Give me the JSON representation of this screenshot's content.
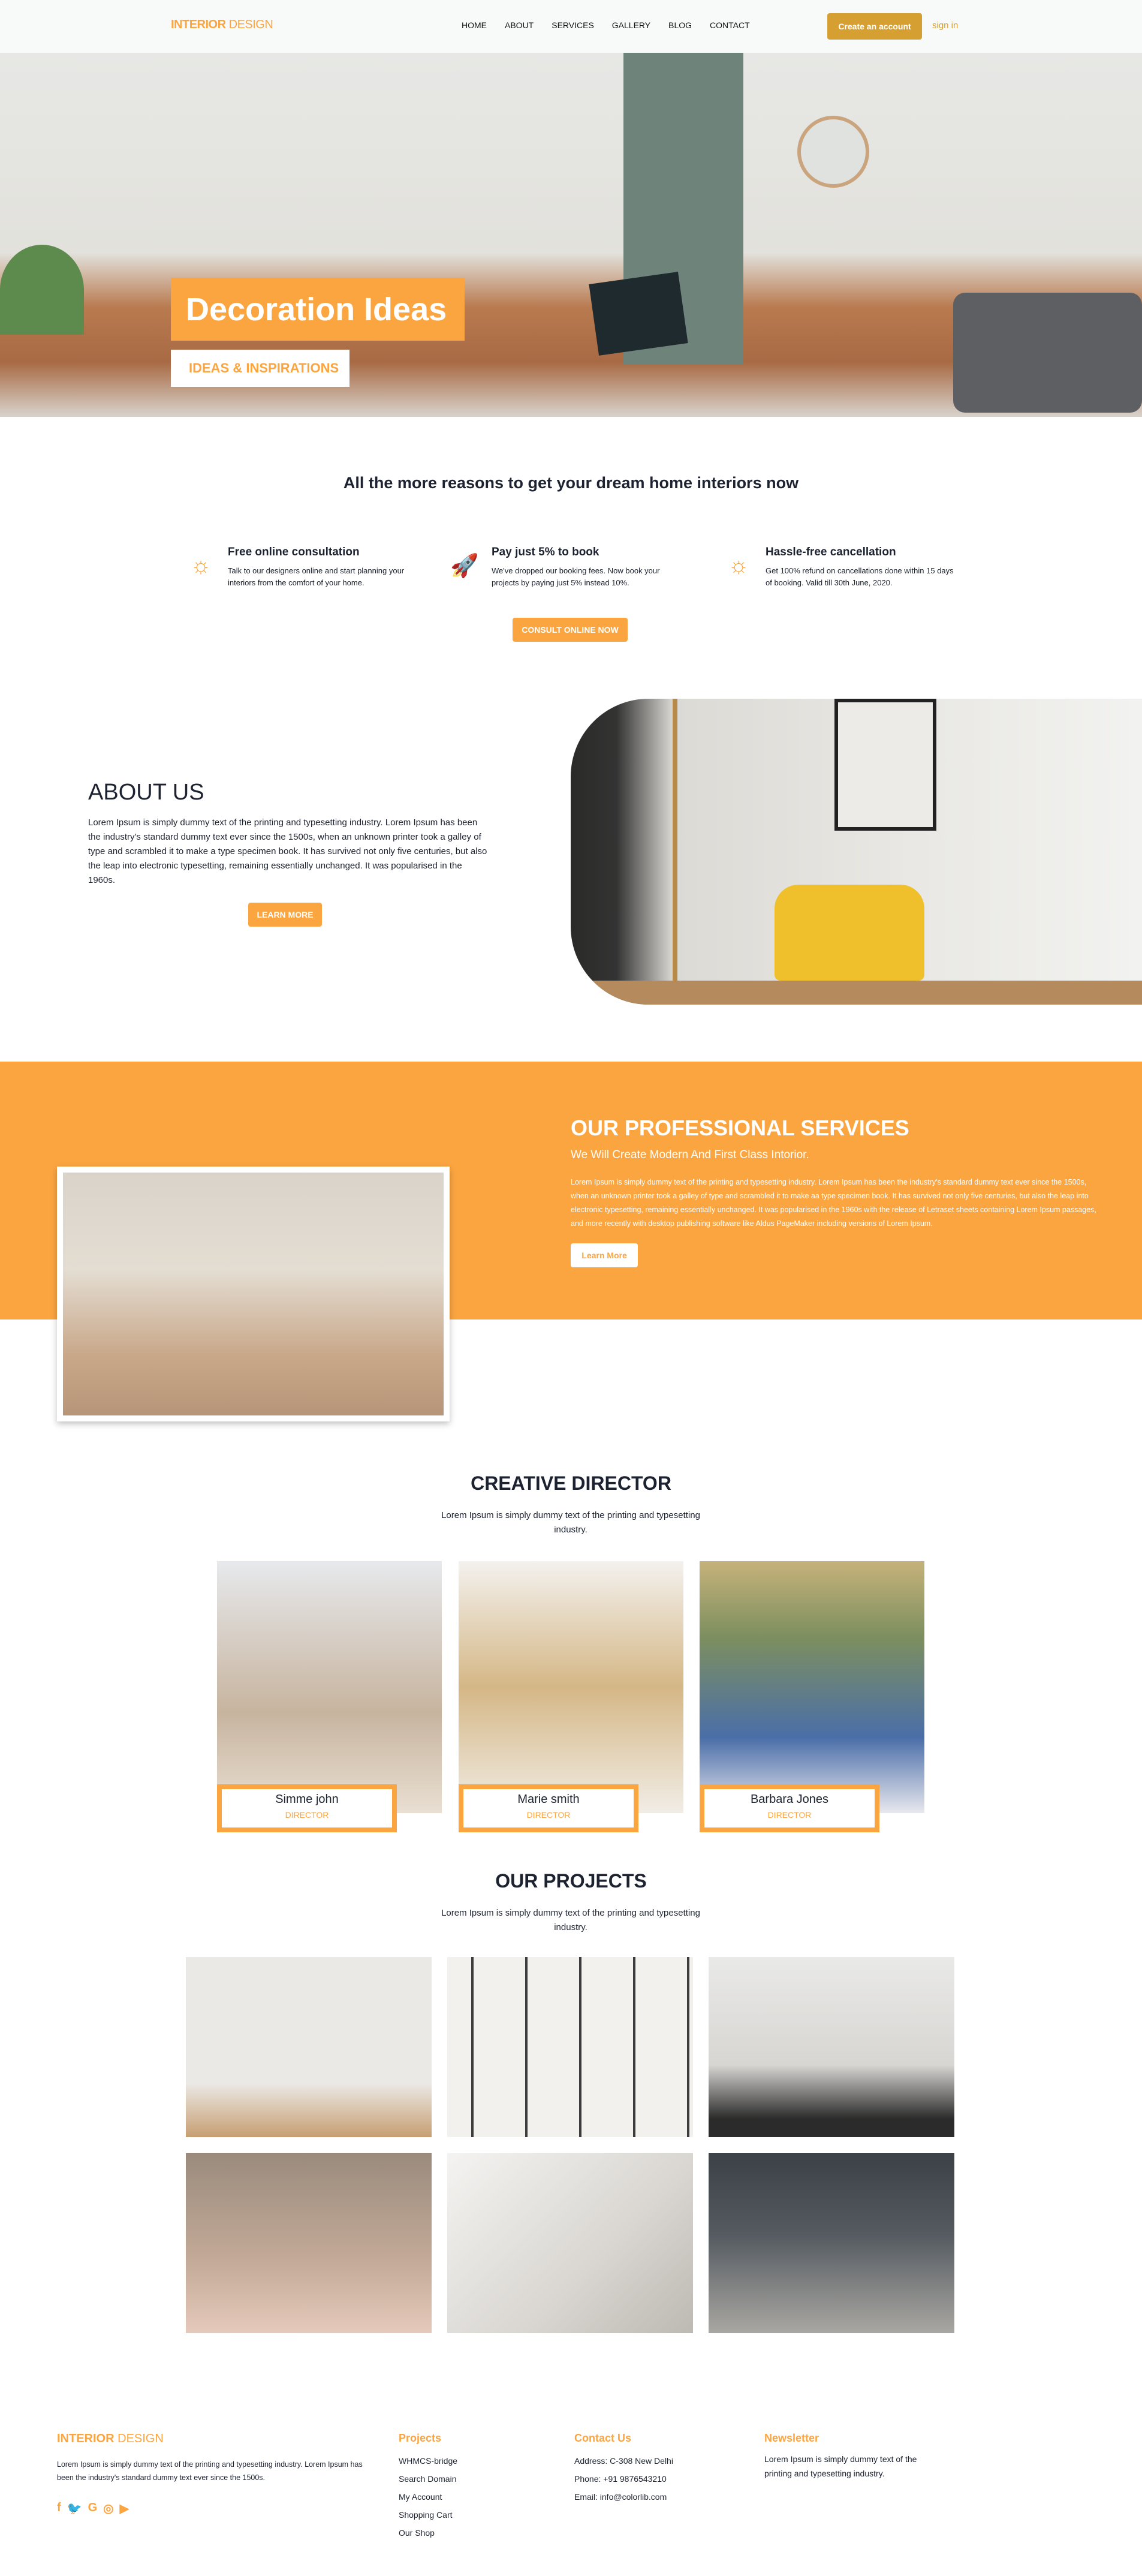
{
  "nav": {
    "logo_bold": "INTERIOR",
    "logo_light": "DESIGN",
    "links": [
      "HOME",
      "ABOUT",
      "SERVICES",
      "GALLERY",
      "BLOG",
      "CONTACT"
    ],
    "create_account": "Create an account",
    "sign_in": "sign in"
  },
  "hero": {
    "title": "Decoration Ideas",
    "subtitle": "IDEAS & INSPIRATIONS"
  },
  "reasons": {
    "title": "All the more reasons to get your dream home interiors now",
    "items": [
      {
        "icon": "bolt-sun-icon",
        "title": "Free online consultation",
        "text": "Talk to our designers online and start planning your interiors from the comfort of your home."
      },
      {
        "icon": "rocket-person-icon",
        "title": "Pay just 5% to book",
        "text": "We've dropped our booking fees. Now book your projects by paying just 5% instead 10%."
      },
      {
        "icon": "bolt-sun-icon",
        "title": "Hassle-free cancellation",
        "text": "Get 100% refund on cancellations done within 15 days of booking. Valid till 30th June, 2020."
      }
    ],
    "button": "CONSULT ONLINE NOW"
  },
  "about": {
    "title": "ABOUT US",
    "text": "Lorem Ipsum is simply dummy text of the printing and typesetting industry. Lorem Ipsum has been the industry's standard dummy text ever since the 1500s, when an unknown printer took a galley of type and scrambled it to make a type specimen book. It has survived not only five centuries, but also the leap into electronic typesetting, remaining essentially unchanged. It was popularised in the 1960s.",
    "button": "LEARN MORE"
  },
  "services": {
    "title": "OUR PROFESSIONAL SERVICES",
    "subtitle": "We Will Create Modern And First Class Intorior.",
    "text": "Lorem Ipsum is simply dummy text of the printing and typesetting industry. Lorem Ipsum has been the industry's standard dummy text ever since the 1500s, when an unknown printer took a galley of type and scrambled it to make aa type specimen book. It has survived not only five centuries, but also the leap into electronic typesetting, remaining essentially unchanged. It was popularised in the 1960s with the release of Letraset sheets containing Lorem Ipsum passages, and more recently with desktop publishing software like Aldus PageMaker including versions of Lorem Ipsum.",
    "button": "Learn More"
  },
  "directors": {
    "title": "CREATIVE DIRECTOR",
    "subtitle": "Lorem Ipsum is simply dummy text of the printing and typesetting industry.",
    "people": [
      {
        "name": "Simme john",
        "role": "DIRECTOR"
      },
      {
        "name": "Marie smith",
        "role": "DIRECTOR"
      },
      {
        "name": "Barbara Jones",
        "role": "DIRECTOR"
      }
    ]
  },
  "projects": {
    "title": "OUR PROJECTS",
    "subtitle": "Lorem Ipsum is simply dummy text of the printing and typesetting industry."
  },
  "footer": {
    "logo_bold": "INTERIOR",
    "logo_light": "DESIGN",
    "about": "Lorem Ipsum is simply dummy text of the printing and typesetting industry. Lorem Ipsum has been the industry's standard dummy text ever since the 1500s.",
    "social": [
      "facebook-icon",
      "twitter-icon",
      "google-icon",
      "instagram-icon",
      "youtube-icon"
    ],
    "projects_title": "Projects",
    "projects_links": [
      "WHMCS-bridge",
      "Search Domain",
      "My Account",
      "Shopping Cart",
      "Our Shop"
    ],
    "contact_title": "Contact Us",
    "contact": [
      "Address: C-308 New Delhi",
      "Phone: +91 9876543210",
      "Email: info@colorlib.com"
    ],
    "newsletter_title": "Newsletter",
    "newsletter_text": "Lorem Ipsum is simply dummy text of the printing and typesetting industry."
  },
  "colors": {
    "accent": "#fba541",
    "button_gold": "#d69f32",
    "text": "#1c2230"
  }
}
